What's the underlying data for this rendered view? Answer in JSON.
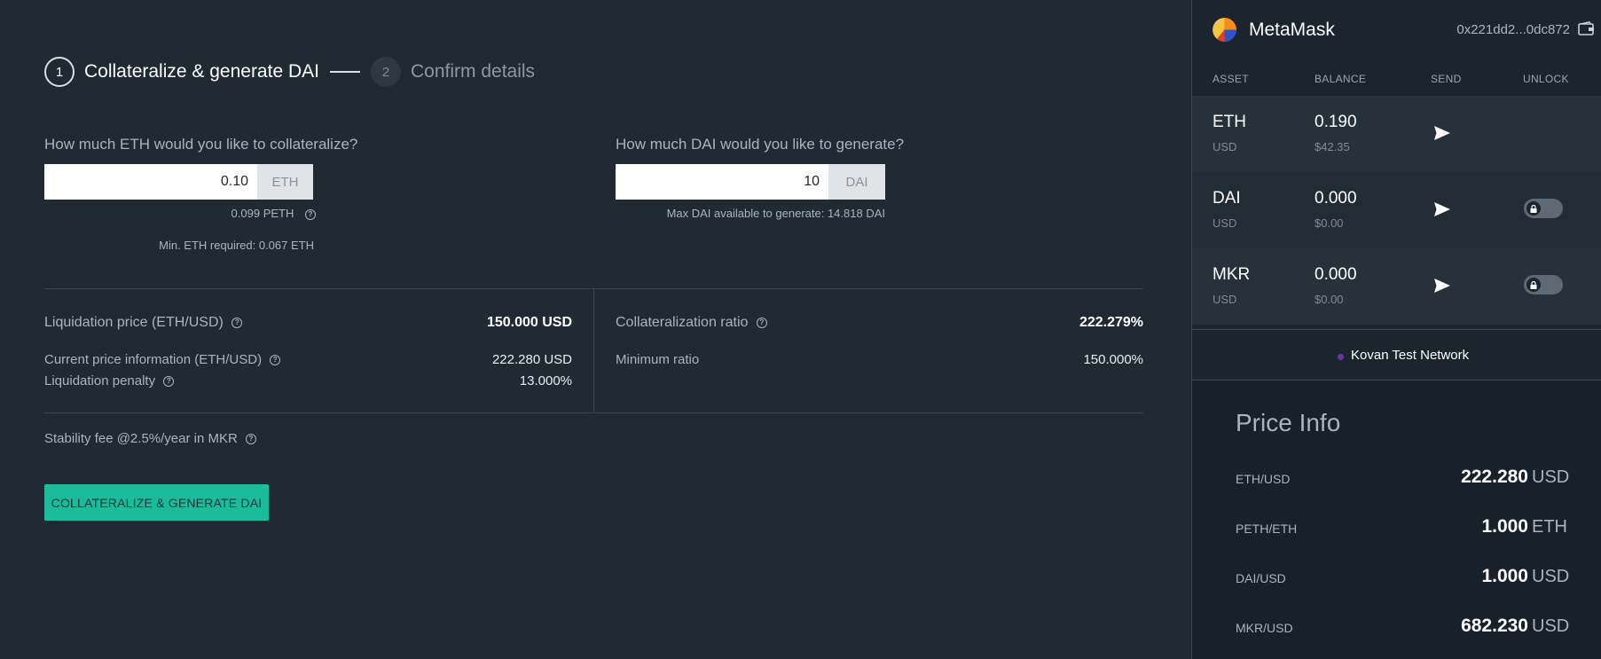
{
  "stepper": {
    "step1_number": "1",
    "step1_label": "Collateralize & generate DAI",
    "step2_number": "2",
    "step2_label": "Confirm details"
  },
  "eth_input": {
    "question": "How much ETH would you like to collateralize?",
    "value": "0.10",
    "unit": "ETH",
    "peth_hint": "0.099 PETH",
    "min_required": "Min. ETH required: 0.067 ETH"
  },
  "dai_input": {
    "question": "How much DAI would you like to generate?",
    "value": "10",
    "unit": "DAI",
    "max_hint": "Max DAI available to generate: 14.818 DAI"
  },
  "details": {
    "liquidation_price_label": "Liquidation price (ETH/USD)",
    "liquidation_price_value": "150.000 USD",
    "current_price_label": "Current price information (ETH/USD)",
    "current_price_value": "222.280 USD",
    "liquidation_penalty_label": "Liquidation penalty",
    "liquidation_penalty_value": "13.000%",
    "collateralization_ratio_label": "Collateralization ratio",
    "collateralization_ratio_value": "222.279%",
    "minimum_ratio_label": "Minimum ratio",
    "minimum_ratio_value": "150.000%",
    "stability_fee_label": "Stability fee @2.5%/year in MKR"
  },
  "submit_label": "COLLATERALIZE & GENERATE DAI",
  "wallet": {
    "title": "MetaMask",
    "address": "0x221dd2...0dc872",
    "columns": [
      "ASSET",
      "BALANCE",
      "SEND",
      "UNLOCK"
    ],
    "assets": [
      {
        "name": "ETH",
        "sub": "USD",
        "balance": "0.190",
        "usd": "$42.35",
        "lockable": false
      },
      {
        "name": "DAI",
        "sub": "USD",
        "balance": "0.000",
        "usd": "$0.00",
        "lockable": true
      },
      {
        "name": "MKR",
        "sub": "USD",
        "balance": "0.000",
        "usd": "$0.00",
        "lockable": true
      }
    ],
    "network": "Kovan Test Network"
  },
  "price_info": {
    "title": "Price Info",
    "rows": [
      {
        "pair": "ETH/USD",
        "value": "222.280",
        "unit": "USD"
      },
      {
        "pair": "PETH/ETH",
        "value": "1.000",
        "unit": "ETH"
      },
      {
        "pair": "DAI/USD",
        "value": "1.000",
        "unit": "USD"
      },
      {
        "pair": "MKR/USD",
        "value": "682.230",
        "unit": "USD"
      }
    ]
  },
  "colors": {
    "accent": "#1abc9c",
    "background": "#212a32",
    "sidebar": "#1c252d",
    "network_dot": "#6b2fb3"
  },
  "icons": {
    "help": "question-circle-icon",
    "send": "paper-plane-icon",
    "lock": "lock-icon",
    "wallet": "wallet-icon",
    "logo": "metamask-logo"
  }
}
